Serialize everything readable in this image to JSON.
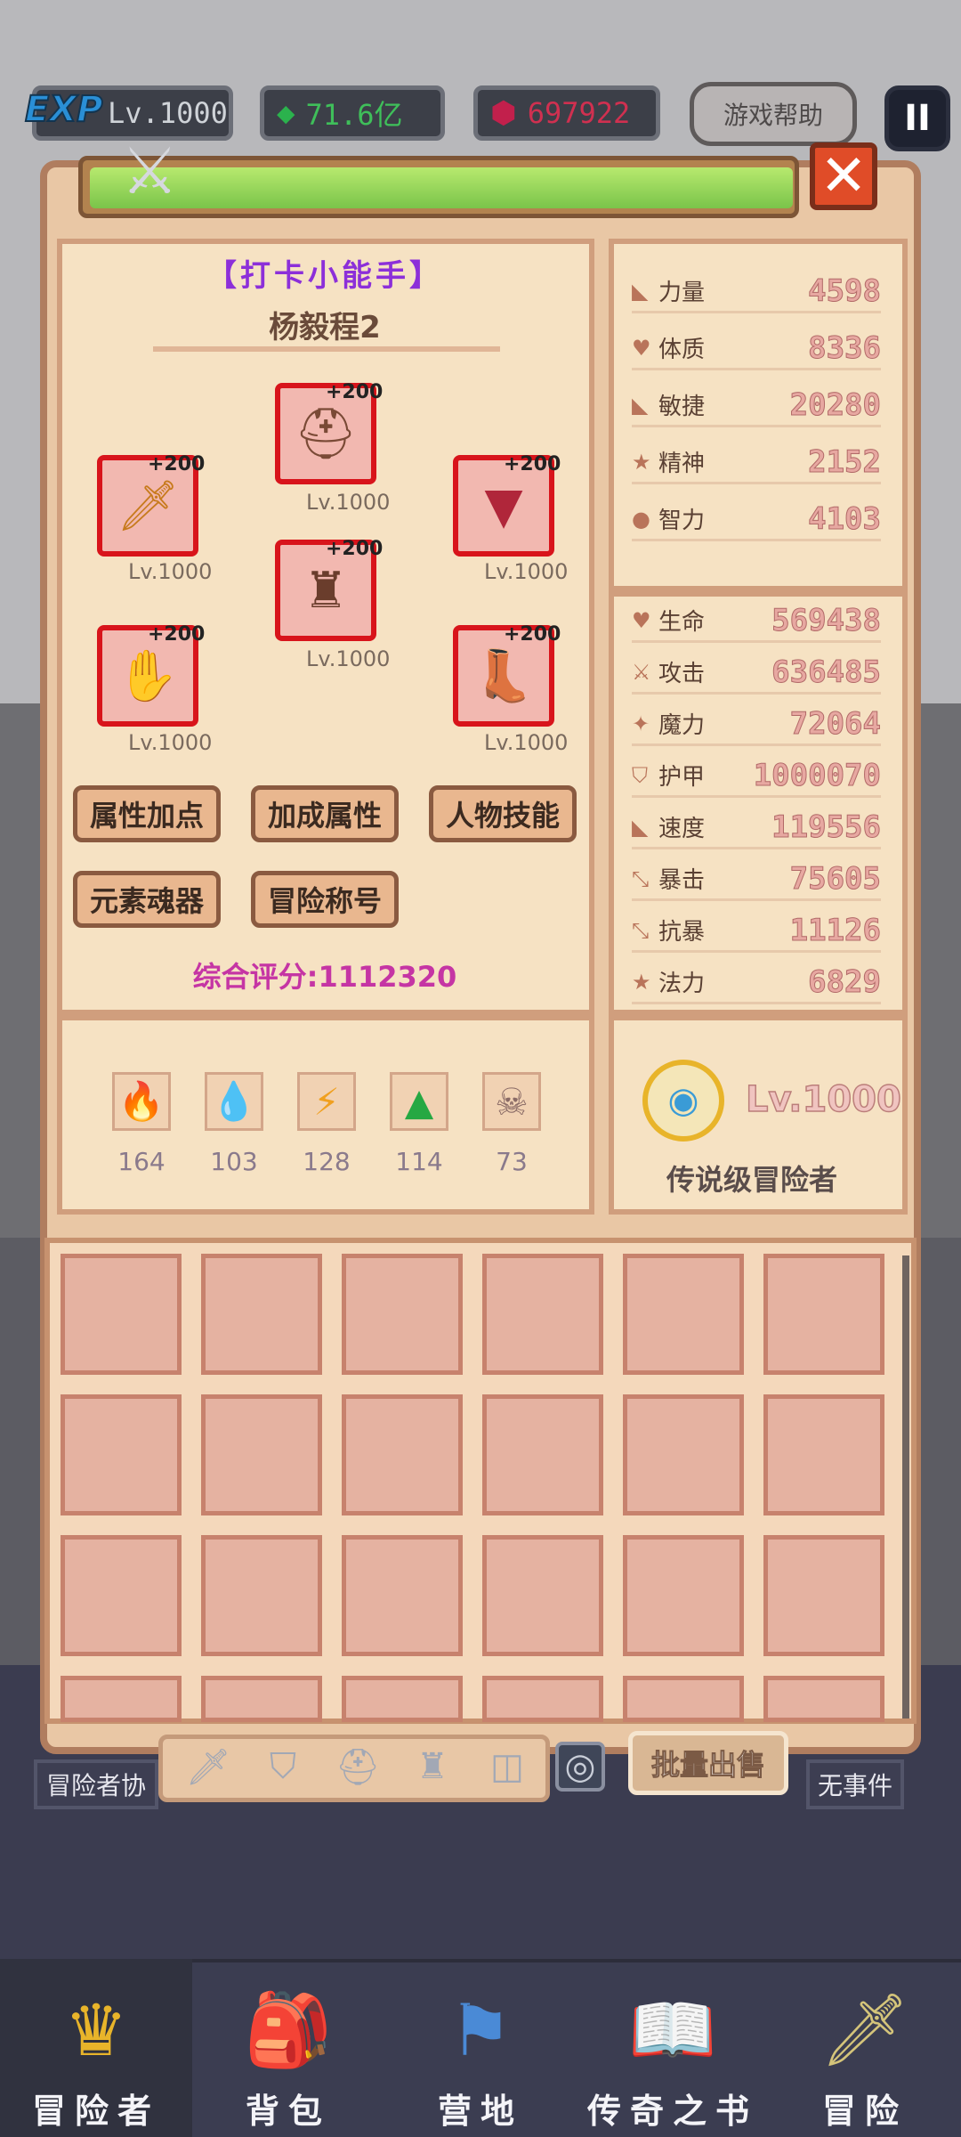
{
  "hud": {
    "exp_label": "EXP",
    "level": "Lv.1000",
    "gems": "71.6亿",
    "rubies": "697922",
    "help_label": "游戏帮助",
    "pause_icon": "II"
  },
  "character": {
    "title": "【打卡小能手】",
    "name": "杨毅程2",
    "score_label": "综合评分:1112320"
  },
  "equipment": [
    {
      "slot": "helmet",
      "plus": "+200",
      "level": "Lv.1000"
    },
    {
      "slot": "weapon",
      "plus": "+200",
      "level": "Lv.1000"
    },
    {
      "slot": "amulet",
      "plus": "+200",
      "level": "Lv.1000"
    },
    {
      "slot": "armor",
      "plus": "+200",
      "level": "Lv.1000"
    },
    {
      "slot": "gloves",
      "plus": "+200",
      "level": "Lv.1000"
    },
    {
      "slot": "boots",
      "plus": "+200",
      "level": "Lv.1000"
    }
  ],
  "buttons": {
    "attr_points": "属性加点",
    "bonus_attr": "加成属性",
    "skills": "人物技能",
    "soul": "元素魂器",
    "adventure_title": "冒险称号"
  },
  "elements": [
    {
      "name": "fire",
      "value": "164"
    },
    {
      "name": "water",
      "value": "103"
    },
    {
      "name": "thunder",
      "value": "128"
    },
    {
      "name": "wood",
      "value": "114"
    },
    {
      "name": "dark",
      "value": "73"
    }
  ],
  "base_stats": [
    {
      "name": "力量",
      "value": "4598"
    },
    {
      "name": "体质",
      "value": "8336"
    },
    {
      "name": "敏捷",
      "value": "20280"
    },
    {
      "name": "精神",
      "value": "2152"
    },
    {
      "name": "智力",
      "value": "4103"
    }
  ],
  "combat_stats": [
    {
      "name": "生命",
      "value": "569438"
    },
    {
      "name": "攻击",
      "value": "636485"
    },
    {
      "name": "魔力",
      "value": "72064"
    },
    {
      "name": "护甲",
      "value": "1000070"
    },
    {
      "name": "速度",
      "value": "119556"
    },
    {
      "name": "暴击",
      "value": "75605"
    },
    {
      "name": "抗暴",
      "value": "11126"
    },
    {
      "name": "法力",
      "value": "6829"
    }
  ],
  "rank": {
    "level": "Lv.1000",
    "label": "传说级冒险者"
  },
  "inventory": {
    "sell_label": "批量出售",
    "left_label": "冒险者协",
    "right_label": "无事件"
  },
  "nav": [
    {
      "label": "冒险者"
    },
    {
      "label": "背包"
    },
    {
      "label": "营地"
    },
    {
      "label": "传奇之书"
    },
    {
      "label": "冒险"
    }
  ]
}
